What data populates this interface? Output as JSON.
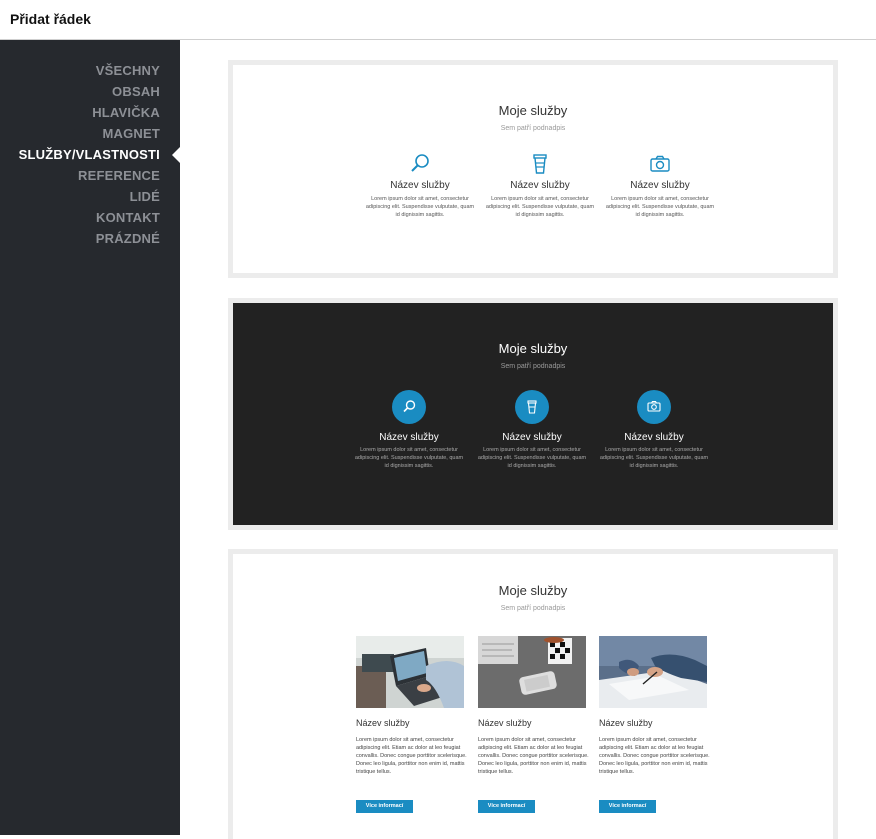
{
  "header": {
    "title": "Přidat řádek"
  },
  "sidebar": {
    "items": [
      {
        "label": "VŠECHNY"
      },
      {
        "label": "OBSAH"
      },
      {
        "label": "HLAVIČKA"
      },
      {
        "label": "MAGNET"
      },
      {
        "label": "SLUŽBY/VLASTNOSTI"
      },
      {
        "label": "REFERENCE"
      },
      {
        "label": "LIDÉ"
      },
      {
        "label": "KONTAKT"
      },
      {
        "label": "PRÁZDNÉ"
      }
    ],
    "active_label": "SLUŽBY/VLASTNOSTI"
  },
  "templates": [
    {
      "theme": "light",
      "title": "Moje služby",
      "subtitle": "Sem patří podnadpis",
      "services": [
        {
          "icon": "magnifier-icon",
          "name": "Název služby",
          "desc": "Lorem ipsum dolor sit amet, consectetur adipiscing elit. Suspendisse vulputate, quam id dignissim sagittis."
        },
        {
          "icon": "cup-icon",
          "name": "Název služby",
          "desc": "Lorem ipsum dolor sit amet, consectetur adipiscing elit. Suspendisse vulputate, quam id dignissim sagittis."
        },
        {
          "icon": "camera-icon",
          "name": "Název služby",
          "desc": "Lorem ipsum dolor sit amet, consectetur adipiscing elit. Suspendisse vulputate, quam id dignissim sagittis."
        }
      ]
    },
    {
      "theme": "dark",
      "title": "Moje služby",
      "subtitle": "Sem patří podnadpis",
      "services": [
        {
          "icon": "magnifier-icon",
          "name": "Název služby",
          "desc": "Lorem ipsum dolor sit amet, consectetur adipiscing elit. Suspendisse vulputate, quam id dignissim sagittis."
        },
        {
          "icon": "cup-icon",
          "name": "Název služby",
          "desc": "Lorem ipsum dolor sit amet, consectetur adipiscing elit. Suspendisse vulputate, quam id dignissim sagittis."
        },
        {
          "icon": "camera-icon",
          "name": "Název služby",
          "desc": "Lorem ipsum dolor sit amet, consectetur adipiscing elit. Suspendisse vulputate, quam id dignissim sagittis."
        }
      ]
    },
    {
      "theme": "light-photos",
      "title": "Moje služby",
      "subtitle": "Sem patří podnadpis",
      "services": [
        {
          "image": "laptop-photo",
          "name": "Název služby",
          "desc": "Lorem ipsum dolor sit amet, consectetur adipiscing elit. Etiam ac dolor at leo feugiat convallis. Donec congue porttitor scelerisque. Donec leo ligula, porttitor non enim id, mattis tristique tellus.",
          "button": "Více informací"
        },
        {
          "image": "phone-coffee-photo",
          "name": "Název služby",
          "desc": "Lorem ipsum dolor sit amet, consectetur adipiscing elit. Etiam ac dolor at leo feugiat convallis. Donec congue porttitor scelerisque. Donec leo ligula, porttitor non enim id, mattis tristique tellus.",
          "button": "Více informací"
        },
        {
          "image": "writing-photo",
          "name": "Název služby",
          "desc": "Lorem ipsum dolor sit amet, consectetur adipiscing elit. Etiam ac dolor at leo feugiat convallis. Donec congue porttitor scelerisque. Donec leo ligula, porttitor non enim id, mattis tristique tellus.",
          "button": "Více informací"
        }
      ]
    }
  ],
  "colors": {
    "accent": "#1a8cc2",
    "sidebar_bg": "#26292e",
    "dark_card_bg": "#222222"
  }
}
